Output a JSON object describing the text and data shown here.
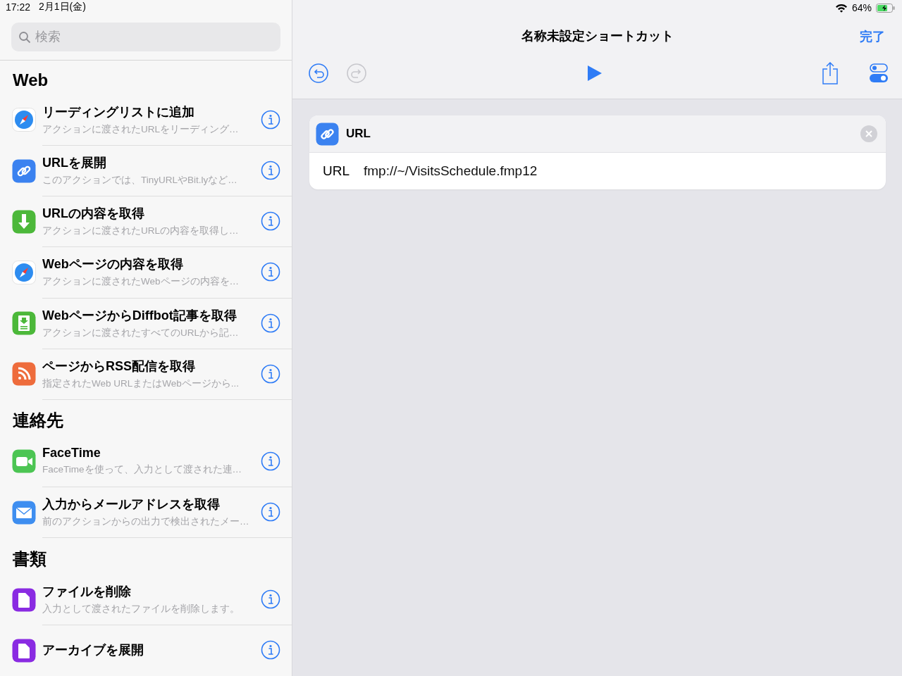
{
  "status_bar": {
    "time": "17:22",
    "date": "2月1日(金)",
    "battery": "64%"
  },
  "sidebar": {
    "search": {
      "placeholder": "検索"
    },
    "sections": [
      {
        "title": "Web",
        "items": [
          {
            "kind": "safari",
            "title": "リーディングリストに追加",
            "subtitle": "アクションに渡されたURLをリーディング…"
          },
          {
            "kind": "link",
            "title": "URLを展開",
            "subtitle": "このアクションでは、TinyURLやBit.lyなど…"
          },
          {
            "kind": "download",
            "title": "URLの内容を取得",
            "subtitle": "アクションに渡されたURLの内容を取得し…"
          },
          {
            "kind": "safari",
            "title": "Webページの内容を取得",
            "subtitle": "アクションに渡されたWebページの内容を…"
          },
          {
            "kind": "article",
            "title": "WebページからDiffbot記事を取得",
            "subtitle": "アクションに渡されたすべてのURLから記…"
          },
          {
            "kind": "rss",
            "title": "ページからRSS配信を取得",
            "subtitle": "指定されたWeb URLまたはWebページから..."
          }
        ]
      },
      {
        "title": "連絡先",
        "items": [
          {
            "kind": "video",
            "title": "FaceTime",
            "subtitle": "FaceTimeを使って、入力として渡された連…"
          },
          {
            "kind": "mail",
            "title": "入力からメールアドレスを取得",
            "subtitle": "前のアクションからの出力で検出されたメー…"
          }
        ]
      },
      {
        "title": "書類",
        "items": [
          {
            "kind": "file",
            "title": "ファイルを削除",
            "subtitle": "入力として渡されたファイルを削除します。"
          },
          {
            "kind": "file",
            "title": "アーカイブを展開"
          }
        ]
      }
    ]
  },
  "editor": {
    "title": "名称未設定ショートカット",
    "done": "完了",
    "toolbar": {
      "undo_disabled": false,
      "redo_disabled": true
    },
    "action": {
      "title": "URL",
      "field_label": "URL",
      "value": "fmp://~/VisitsSchedule.fmp12"
    }
  }
}
